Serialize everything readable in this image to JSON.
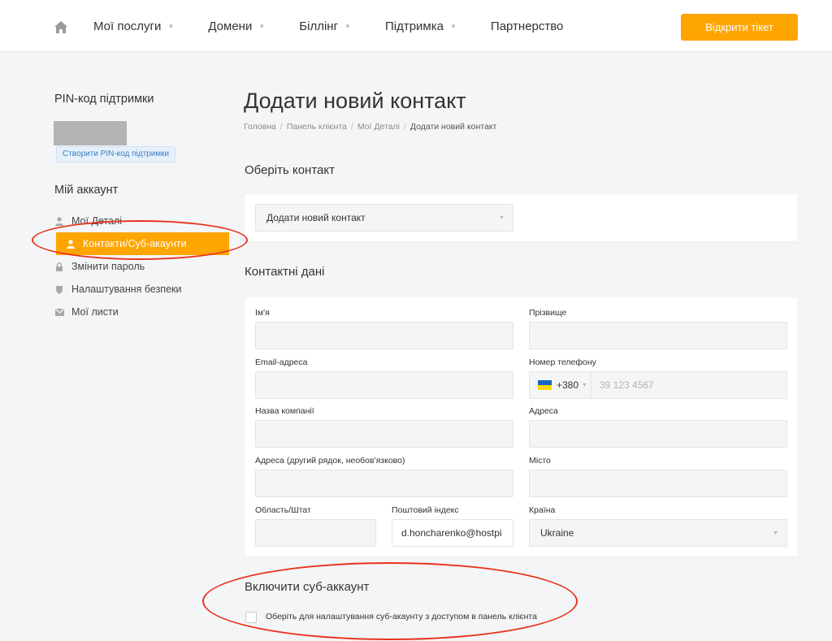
{
  "header": {
    "nav": [
      {
        "label": "Мої послуги",
        "has_dropdown": true
      },
      {
        "label": "Домени",
        "has_dropdown": true
      },
      {
        "label": "Біллінг",
        "has_dropdown": true
      },
      {
        "label": "Підтримка",
        "has_dropdown": true
      },
      {
        "label": "Партнерство",
        "has_dropdown": false
      }
    ],
    "ticket_button": "Відкрити тікет",
    "accent_color": "#ffa500"
  },
  "sidebar": {
    "pin_title": "PIN-код підтримки",
    "pin_button": "Створити PIN-код підтримки",
    "account_title": "Мій аккаунт",
    "items": [
      {
        "label": "Мої Деталі",
        "icon": "user-icon",
        "active": false
      },
      {
        "label": "Контакти/Суб-акаунти",
        "icon": "user-icon",
        "active": true
      },
      {
        "label": "Змінити пароль",
        "icon": "lock-icon",
        "active": false
      },
      {
        "label": "Налаштування безпеки",
        "icon": "shield-icon",
        "active": false
      },
      {
        "label": "Мої листи",
        "icon": "envelope-icon",
        "active": false
      }
    ]
  },
  "main": {
    "title": "Додати новий контакт",
    "breadcrumb": [
      "Головна",
      "Панель клієнта",
      "Мої Деталі",
      "Додати новий контакт"
    ],
    "choose_contact_title": "Оберіть контакт",
    "contact_select_value": "Додати новий контакт",
    "contact_details_title": "Контактні дані",
    "fields": {
      "first_name": {
        "label": "Ім'я",
        "value": ""
      },
      "last_name": {
        "label": "Прізвище",
        "value": ""
      },
      "email": {
        "label": "Email-адреса",
        "value": ""
      },
      "phone": {
        "label": "Номер телефону",
        "code": "+380",
        "placeholder": "39 123 4567"
      },
      "company": {
        "label": "Назва компанії",
        "value": ""
      },
      "address": {
        "label": "Адреса",
        "value": ""
      },
      "address2": {
        "label": "Адреса (другий рядок, необов'язково)",
        "value": ""
      },
      "city": {
        "label": "Місто",
        "value": ""
      },
      "state": {
        "label": "Область/Штат",
        "value": ""
      },
      "postcode": {
        "label": "Поштовий індекс",
        "value": "d.honcharenko@hostpi"
      },
      "country": {
        "label": "Країна",
        "value": "Ukraine"
      }
    },
    "subaccount_title": "Включити суб-аккаунт",
    "subaccount_checkbox_label": "Оберіть для налаштування суб-акаунту з доступом в панель клієнта"
  },
  "annotation_color": "#e8331c"
}
